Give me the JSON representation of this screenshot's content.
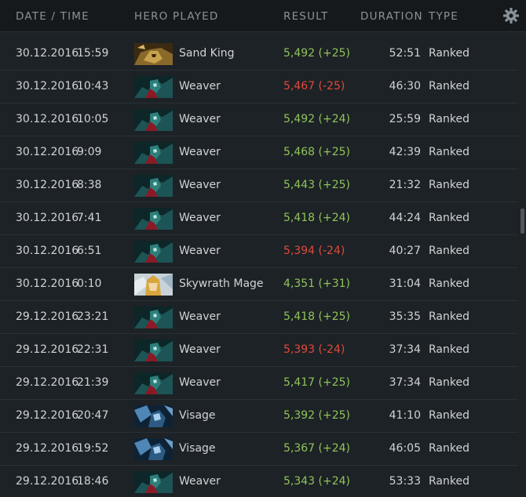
{
  "header": {
    "date_time": "DATE / TIME",
    "hero_played": "HERO PLAYED",
    "result": "RESULT",
    "duration": "DURATION",
    "type": "TYPE",
    "settings_icon": "gear-icon"
  },
  "colors": {
    "win": "#8fc35a",
    "loss": "#e0493a",
    "text": "#d0d4d7",
    "header_text": "#8a9299",
    "background": "#1d2226"
  },
  "matches": [
    {
      "date": "30.12.2016",
      "time": "15:59",
      "hero": "Sand King",
      "portrait": "sand-king-portrait",
      "result": "5,492 (+25)",
      "outcome": "win",
      "duration": "52:51",
      "type": "Ranked"
    },
    {
      "date": "30.12.2016",
      "time": "10:43",
      "hero": "Weaver",
      "portrait": "weaver-portrait",
      "result": "5,467 (-25)",
      "outcome": "loss",
      "duration": "46:30",
      "type": "Ranked"
    },
    {
      "date": "30.12.2016",
      "time": "10:05",
      "hero": "Weaver",
      "portrait": "weaver-portrait",
      "result": "5,492 (+24)",
      "outcome": "win",
      "duration": "25:59",
      "type": "Ranked"
    },
    {
      "date": "30.12.2016",
      "time": "9:09",
      "hero": "Weaver",
      "portrait": "weaver-portrait",
      "result": "5,468 (+25)",
      "outcome": "win",
      "duration": "42:39",
      "type": "Ranked"
    },
    {
      "date": "30.12.2016",
      "time": "8:38",
      "hero": "Weaver",
      "portrait": "weaver-portrait",
      "result": "5,443 (+25)",
      "outcome": "win",
      "duration": "21:32",
      "type": "Ranked"
    },
    {
      "date": "30.12.2016",
      "time": "7:41",
      "hero": "Weaver",
      "portrait": "weaver-portrait",
      "result": "5,418 (+24)",
      "outcome": "win",
      "duration": "44:24",
      "type": "Ranked"
    },
    {
      "date": "30.12.2016",
      "time": "6:51",
      "hero": "Weaver",
      "portrait": "weaver-portrait",
      "result": "5,394 (-24)",
      "outcome": "loss",
      "duration": "40:27",
      "type": "Ranked"
    },
    {
      "date": "30.12.2016",
      "time": "0:10",
      "hero": "Skywrath Mage",
      "portrait": "skywrath-mage-portrait",
      "result": "4,351 (+31)",
      "outcome": "win",
      "duration": "31:04",
      "type": "Ranked"
    },
    {
      "date": "29.12.2016",
      "time": "23:21",
      "hero": "Weaver",
      "portrait": "weaver-portrait",
      "result": "5,418 (+25)",
      "outcome": "win",
      "duration": "35:35",
      "type": "Ranked"
    },
    {
      "date": "29.12.2016",
      "time": "22:31",
      "hero": "Weaver",
      "portrait": "weaver-portrait",
      "result": "5,393 (-24)",
      "outcome": "loss",
      "duration": "37:34",
      "type": "Ranked"
    },
    {
      "date": "29.12.2016",
      "time": "21:39",
      "hero": "Weaver",
      "portrait": "weaver-portrait",
      "result": "5,417 (+25)",
      "outcome": "win",
      "duration": "37:34",
      "type": "Ranked"
    },
    {
      "date": "29.12.2016",
      "time": "20:47",
      "hero": "Visage",
      "portrait": "visage-portrait",
      "result": "5,392 (+25)",
      "outcome": "win",
      "duration": "41:10",
      "type": "Ranked"
    },
    {
      "date": "29.12.2016",
      "time": "19:52",
      "hero": "Visage",
      "portrait": "visage-portrait",
      "result": "5,367 (+24)",
      "outcome": "win",
      "duration": "46:05",
      "type": "Ranked"
    },
    {
      "date": "29.12.2016",
      "time": "18:46",
      "hero": "Weaver",
      "portrait": "weaver-portrait",
      "result": "5,343 (+24)",
      "outcome": "win",
      "duration": "53:33",
      "type": "Ranked"
    }
  ]
}
